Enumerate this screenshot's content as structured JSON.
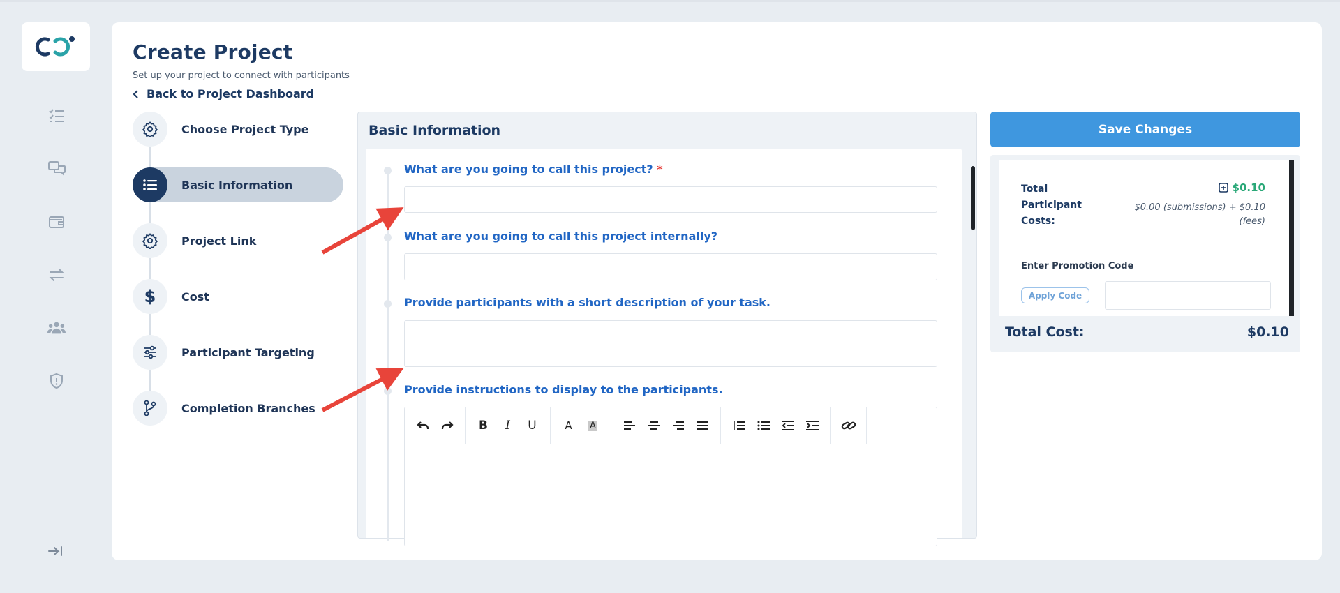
{
  "header": {
    "title": "Create Project",
    "subtitle": "Set up your project to connect with participants",
    "back_label": "Back to Project Dashboard"
  },
  "sidebar": {
    "icons": [
      "checklist-icon",
      "chat-icon",
      "wallet-icon",
      "transfer-icon",
      "users-icon",
      "shield-icon"
    ],
    "collapse_icon": "collapse-arrow-icon"
  },
  "steps": [
    {
      "label": "Choose Project Type",
      "icon": "gear-icon",
      "active": false
    },
    {
      "label": "Basic Information",
      "icon": "list-icon",
      "active": true
    },
    {
      "label": "Project Link",
      "icon": "gear-icon",
      "active": false
    },
    {
      "label": "Cost",
      "icon": "dollar-icon",
      "active": false
    },
    {
      "label": "Participant Targeting",
      "icon": "sliders-icon",
      "active": false
    },
    {
      "label": "Completion Branches",
      "icon": "branch-icon",
      "active": false
    }
  ],
  "panel": {
    "title": "Basic Information",
    "questions": [
      {
        "label": "What are you going to call this project?",
        "required_mark": "*",
        "value": ""
      },
      {
        "label": "What are you going to call this project internally?",
        "value": ""
      },
      {
        "label": "Provide participants with a short description of your task.",
        "value": ""
      },
      {
        "label": "Provide instructions to display to the participants.",
        "value": ""
      }
    ]
  },
  "editor_toolbar": [
    "undo-icon",
    "redo-icon",
    "bold-icon",
    "italic-icon",
    "underline-icon",
    "font-color-icon",
    "highlight-icon",
    "align-left-icon",
    "align-center-icon",
    "align-right-icon",
    "justify-icon",
    "numbered-list-icon",
    "bullet-list-icon",
    "outdent-icon",
    "indent-icon",
    "link-icon"
  ],
  "editor_glyphs": {
    "bold": "B",
    "italic": "I",
    "underline": "U",
    "font_color": "A",
    "highlight": "A"
  },
  "summary": {
    "save_label": "Save Changes",
    "total_participant_costs_label": "Total Participant Costs:",
    "amount": "$0.10",
    "breakdown": "$0.00 (submissions) + $0.10 (fees)",
    "promo_label": "Enter Promotion Code",
    "apply_label": "Apply Code",
    "promo_value": "",
    "total_cost_label": "Total Cost:",
    "total_cost_value": "$0.10"
  },
  "colors": {
    "primary_navy": "#1d3a63",
    "link_blue": "#2166c4",
    "save_button": "#3f97df",
    "amount_green": "#2aa878",
    "required_red": "#e53935",
    "annotation_arrow": "#e8443a"
  }
}
